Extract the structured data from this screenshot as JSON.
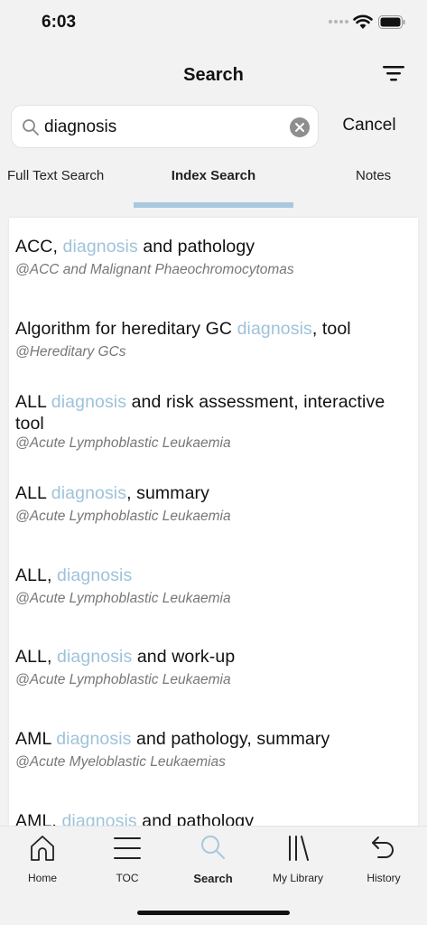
{
  "status_bar": {
    "time": "6:03"
  },
  "header": {
    "title": "Search"
  },
  "search": {
    "value": "diagnosis",
    "cancel_label": "Cancel"
  },
  "tabs": [
    {
      "label": "Full Text Search"
    },
    {
      "label": "Index Search",
      "active": true
    },
    {
      "label": "Notes"
    }
  ],
  "results": [
    {
      "before": "ACC, ",
      "highlight": "diagnosis",
      "after": " and pathology",
      "source": "@ACC and Malignant Phaeochromocytomas"
    },
    {
      "before": "Algorithm for hereditary GC ",
      "highlight": "diagnosis",
      "after": ", tool",
      "source": "@Hereditary GCs"
    },
    {
      "before": "ALL ",
      "highlight": "diagnosis",
      "after": " and risk assessment, interactive tool",
      "source": "@Acute Lymphoblastic Leukaemia"
    },
    {
      "before": "ALL ",
      "highlight": "diagnosis",
      "after": ", summary",
      "source": "@Acute Lymphoblastic Leukaemia"
    },
    {
      "before": "ALL, ",
      "highlight": "diagnosis",
      "after": "",
      "source": "@Acute Lymphoblastic Leukaemia"
    },
    {
      "before": "ALL, ",
      "highlight": "diagnosis",
      "after": " and work-up",
      "source": "@Acute Lymphoblastic Leukaemia"
    },
    {
      "before": "AML ",
      "highlight": "diagnosis",
      "after": " and pathology, summary",
      "source": "@Acute Myeloblastic Leukaemias"
    },
    {
      "before": "AML, ",
      "highlight": "diagnosis",
      "after": " and pathology",
      "source": ""
    }
  ],
  "bottom_nav": [
    {
      "label": "Home",
      "icon": "home-icon"
    },
    {
      "label": "TOC",
      "icon": "menu-icon"
    },
    {
      "label": "Search",
      "icon": "search-icon",
      "active": true
    },
    {
      "label": "My Library",
      "icon": "library-icon"
    },
    {
      "label": "History",
      "icon": "undo-icon"
    }
  ],
  "colors": {
    "highlight": "#9dc3da",
    "tab_indicator": "#a8c8de",
    "active_nav": "#a8c8de"
  }
}
